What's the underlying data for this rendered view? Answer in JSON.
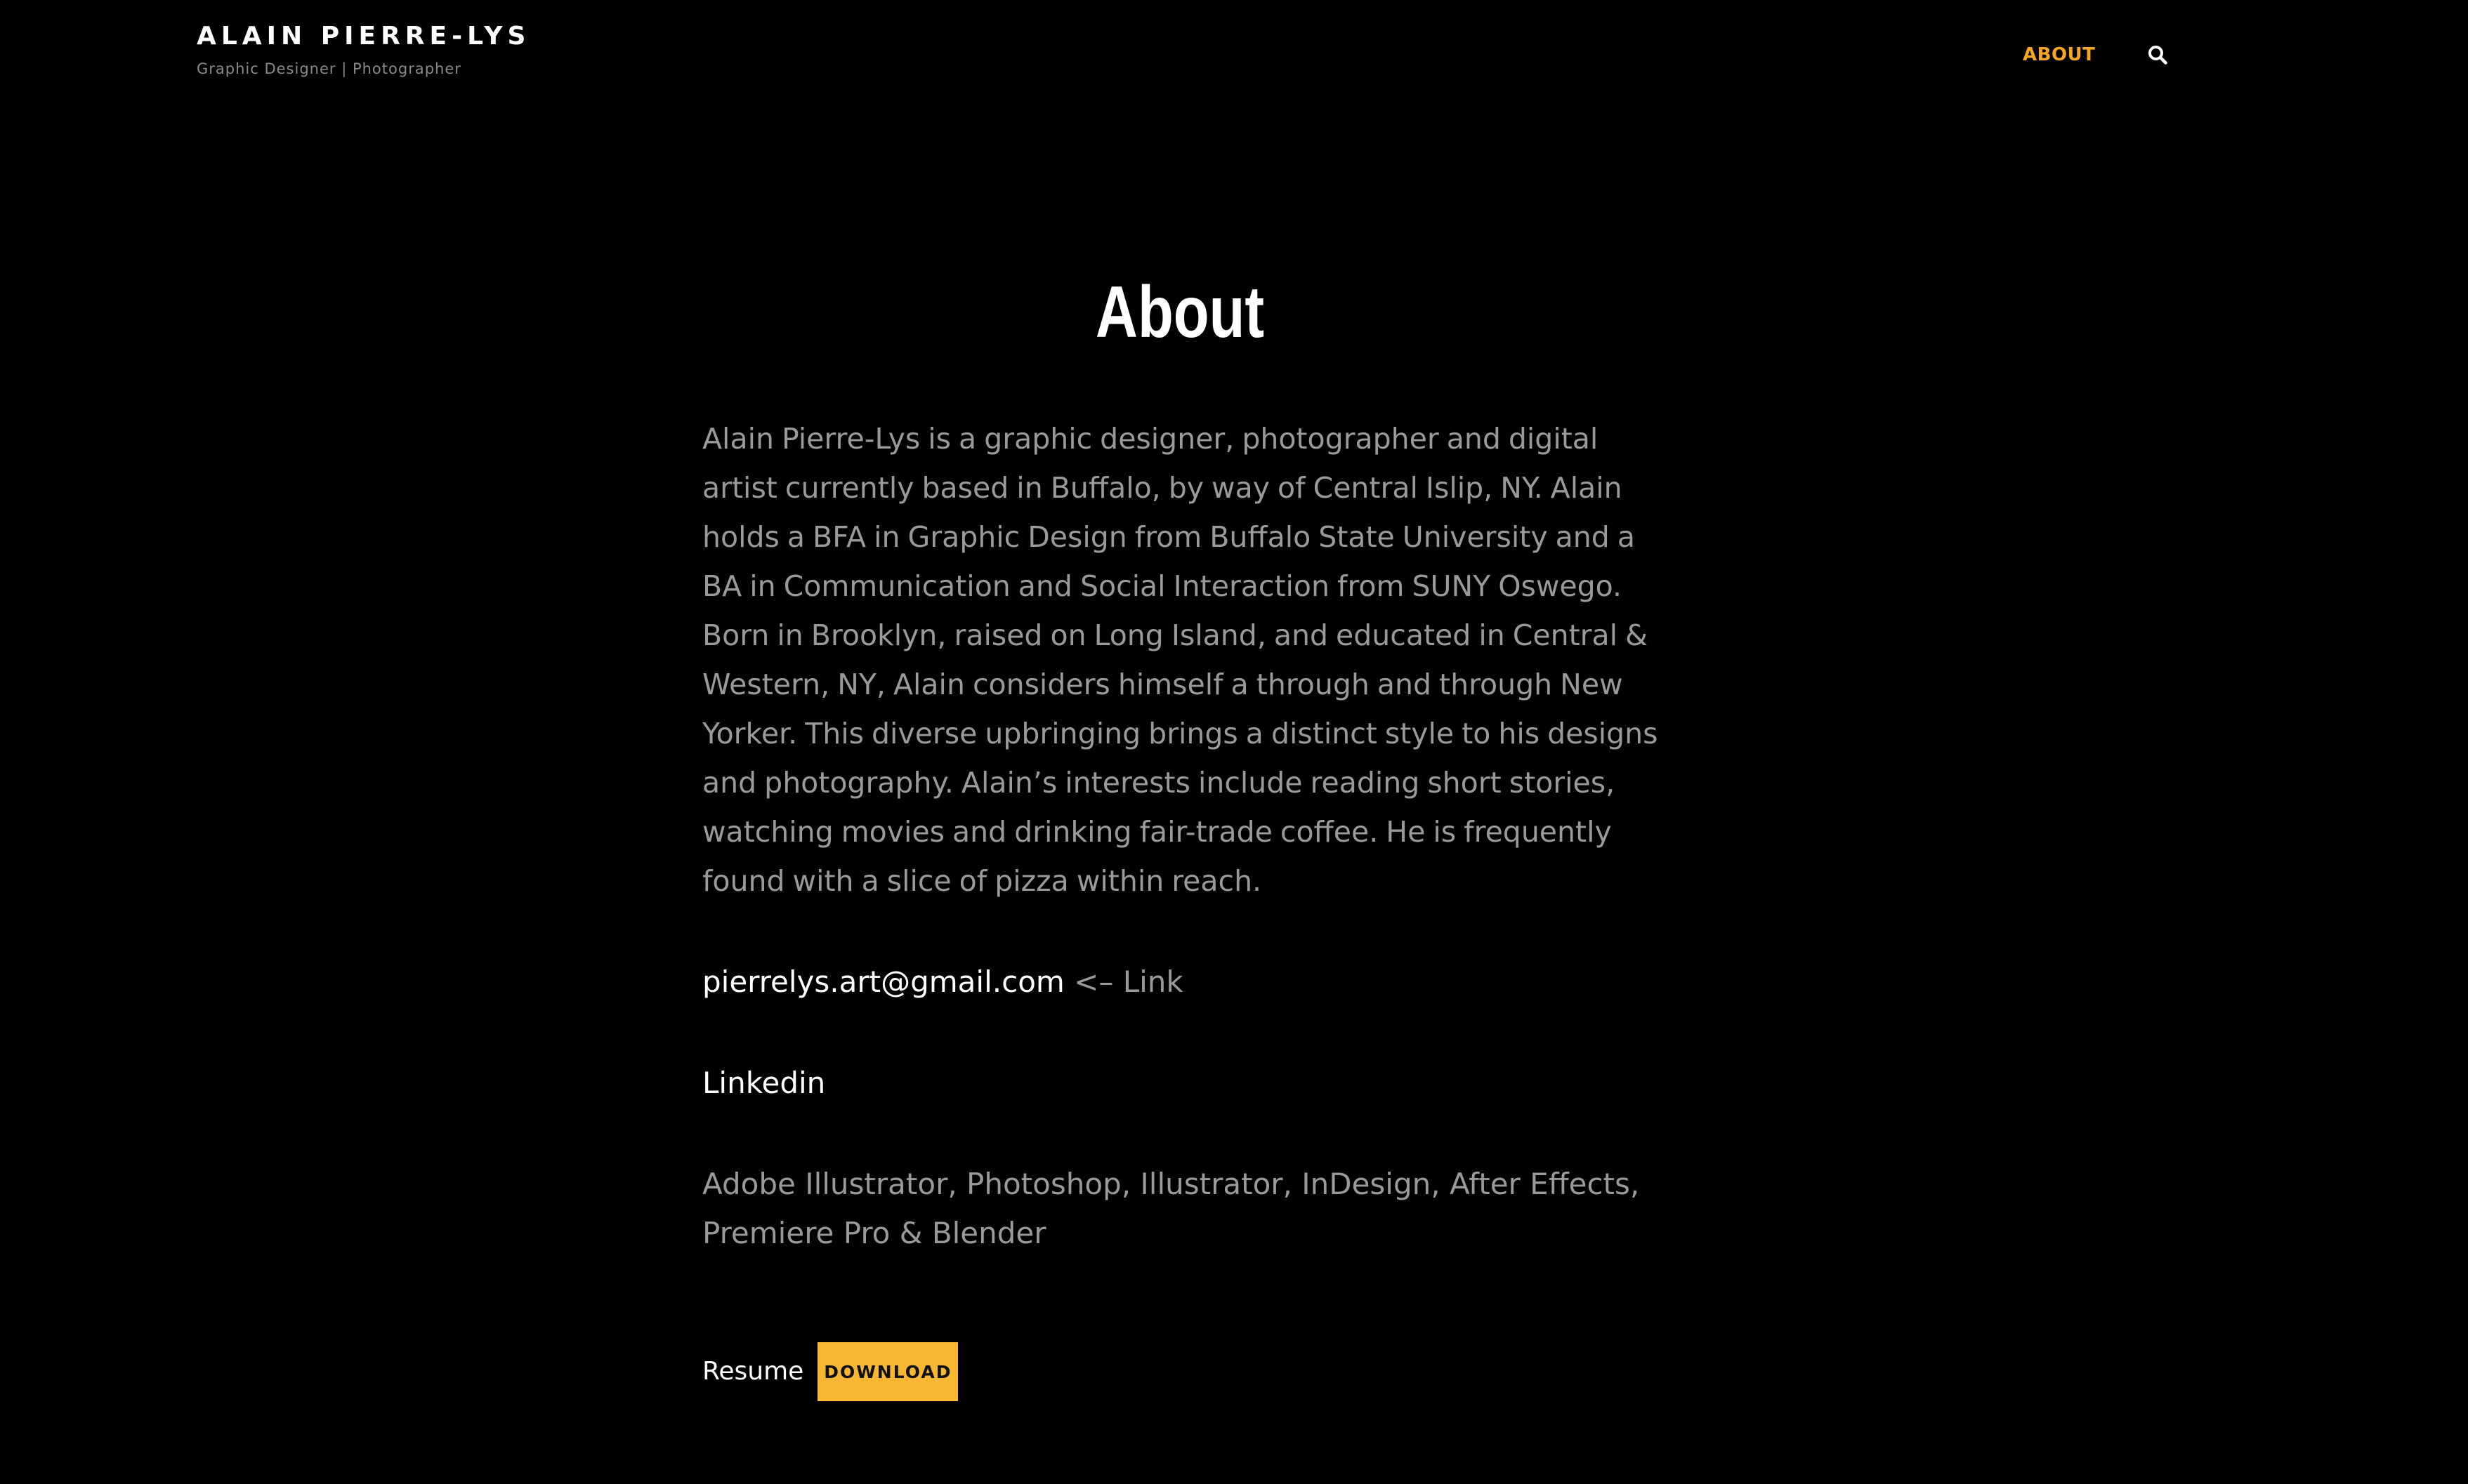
{
  "header": {
    "site_title": "ALAIN PIERRE-LYS",
    "tagline": "Graphic Designer | Photographer",
    "nav": {
      "about_label": "ABOUT",
      "search_icon": "search-icon"
    }
  },
  "main": {
    "title": "About",
    "bio": "Alain Pierre-Lys is a graphic designer, photographer and digital artist currently based in Buffalo, by way of Central Islip, NY. Alain holds a BFA in Graphic Design from Buffalo State University and a BA in Communication and Social Interaction from SUNY Oswego. Born in Brooklyn, raised on Long Island, and educated in Central & Western, NY, Alain considers himself a through and through New Yorker. This diverse upbringing brings a distinct style to his designs and photography. Alain’s interests include reading short stories, watching movies and drinking fair-trade coffee. He is frequently found with a slice of pizza within reach.",
    "email": "pierrelys.art@gmail.com",
    "email_suffix": " <– Link",
    "linkedin_label": "Linkedin",
    "skills": "Adobe Illustrator, Photoshop, Illustrator, InDesign, After Effects, Premiere Pro & Blender",
    "resume_label": "Resume",
    "download_label": "DOWNLOAD"
  },
  "colors": {
    "background": "#000000",
    "accent_nav": "#f5a623",
    "button": "#f7b733",
    "body_text": "#9a9a9a",
    "heading": "#ffffff"
  }
}
